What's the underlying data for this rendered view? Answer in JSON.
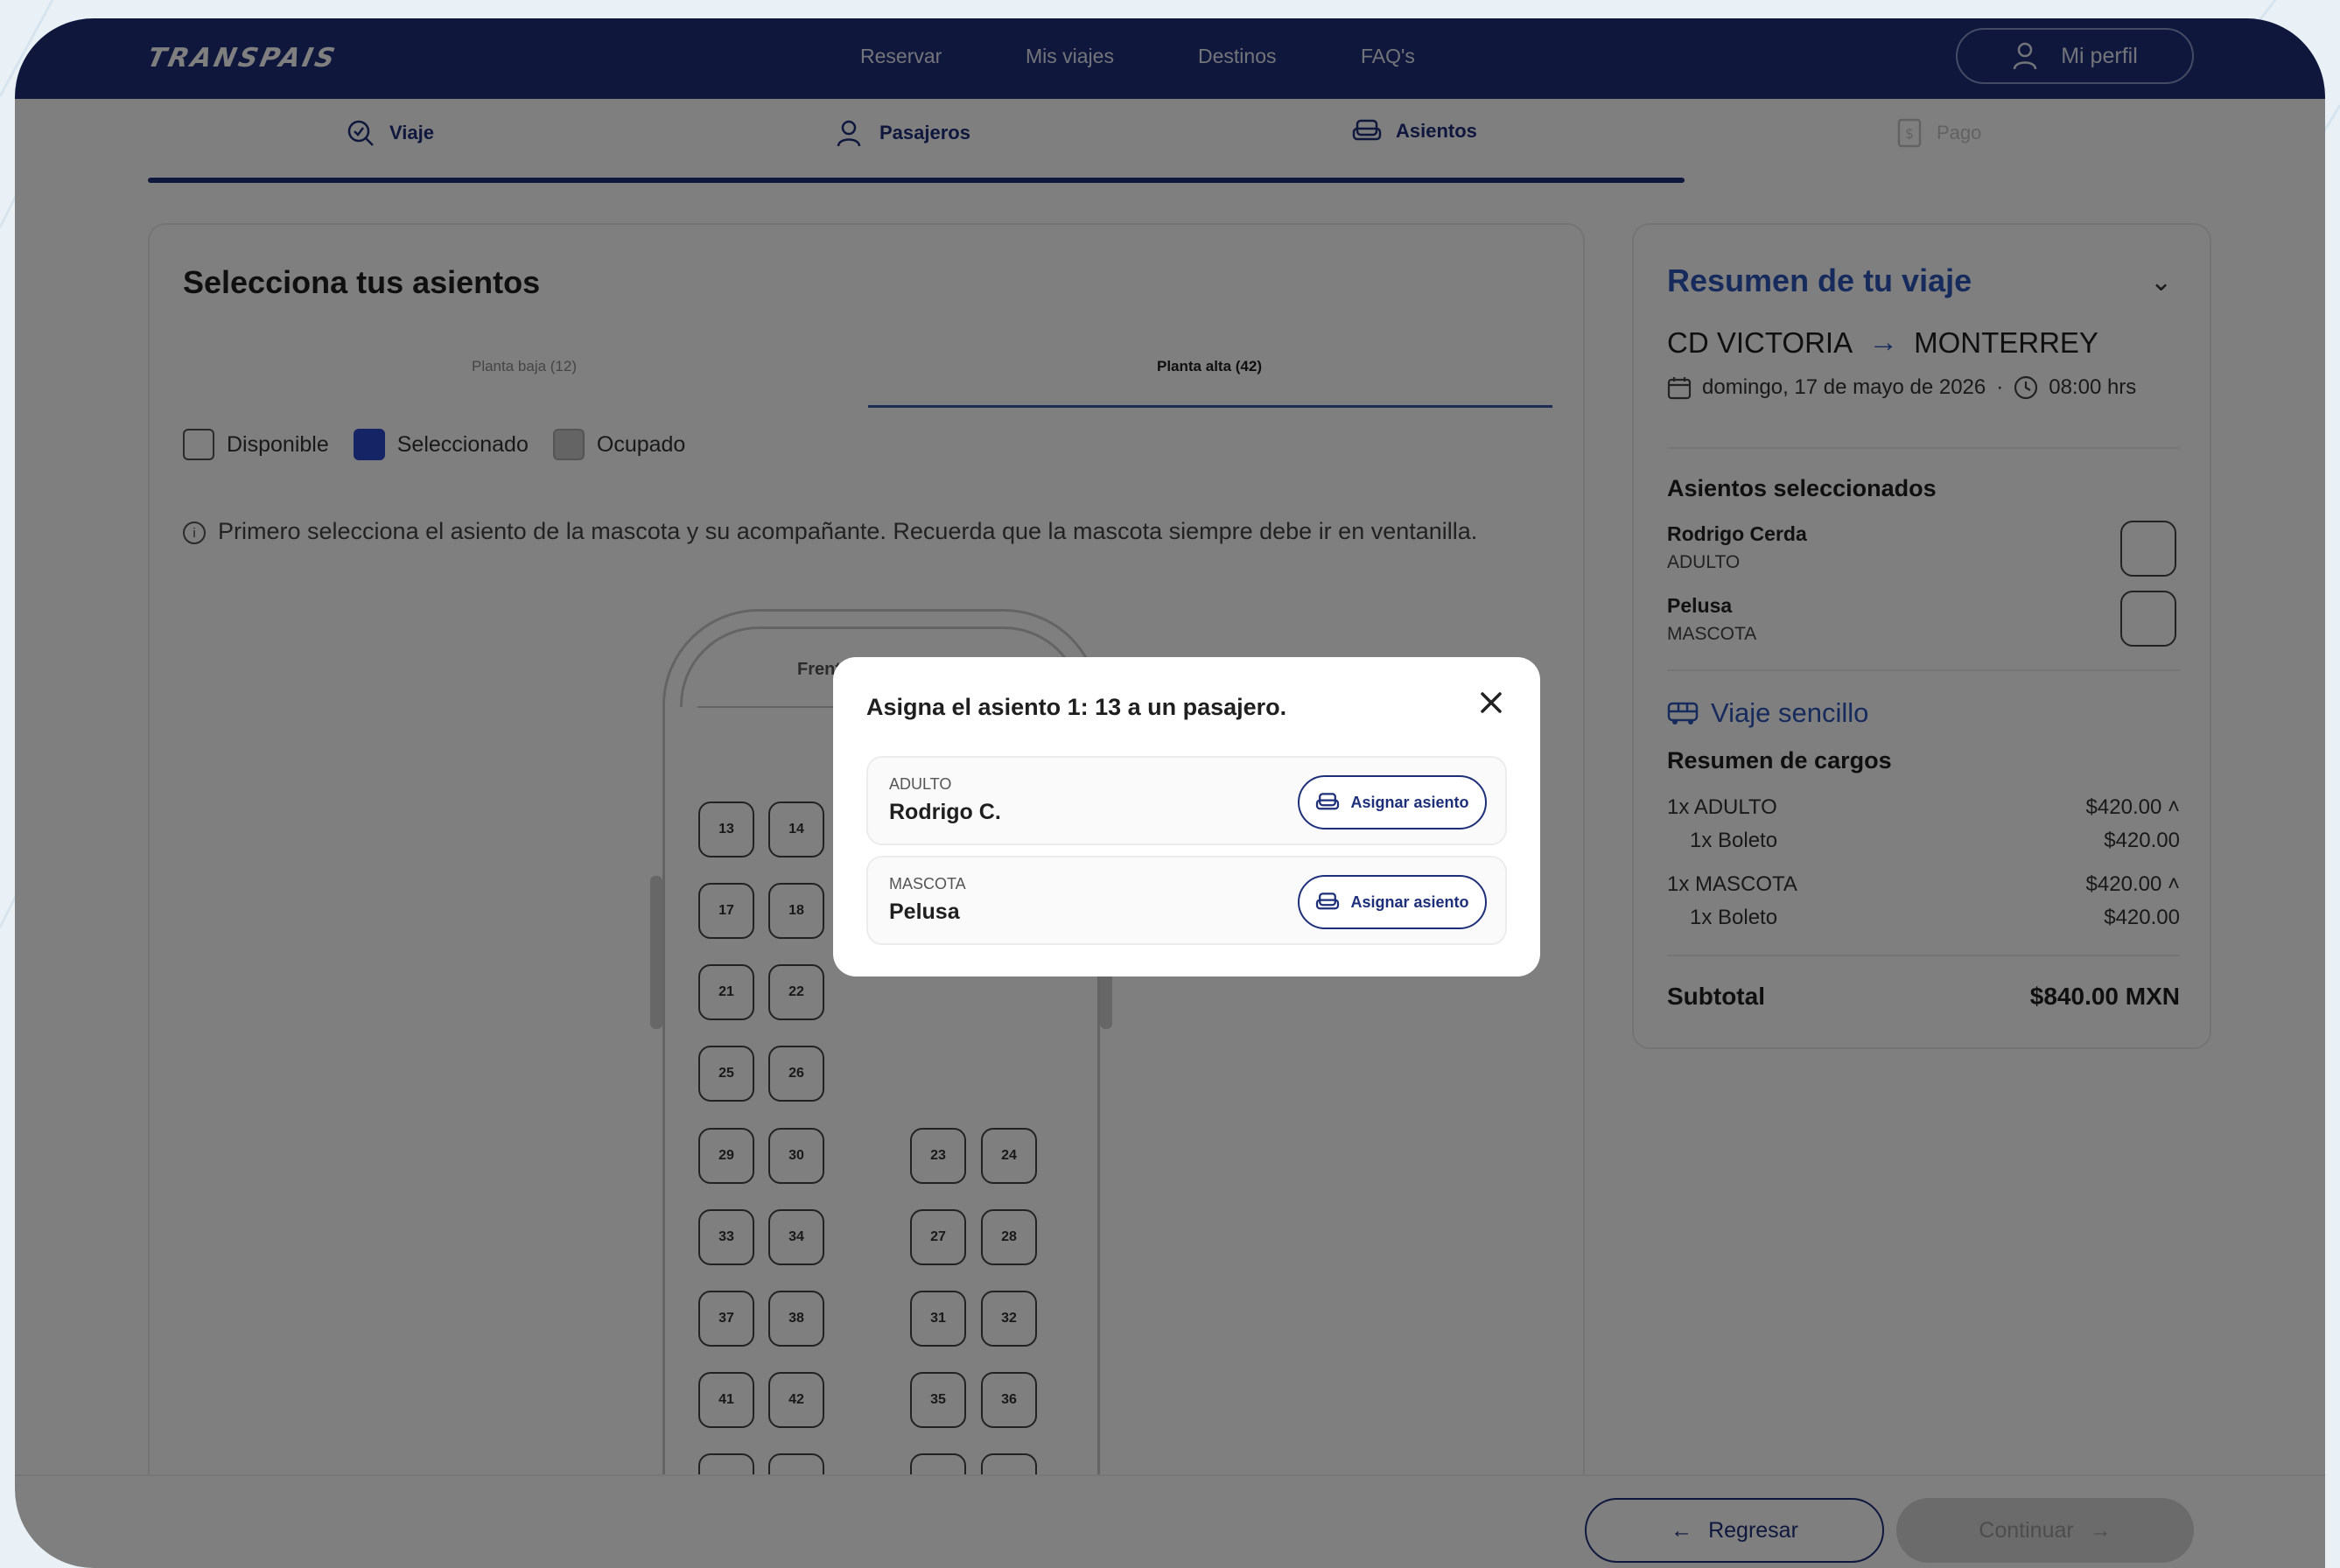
{
  "brand": {
    "logo_text": "Transpais"
  },
  "nav": {
    "items": [
      {
        "label": "Reservar"
      },
      {
        "label": "Mis viajes"
      },
      {
        "label": "Destinos"
      },
      {
        "label": "FAQ's"
      }
    ],
    "profile_label": "Mi perfil"
  },
  "steps": [
    {
      "label": "Viaje",
      "icon": "search-check-icon",
      "state": "done"
    },
    {
      "label": "Pasajeros",
      "icon": "user-icon",
      "state": "done"
    },
    {
      "label": "Asientos",
      "icon": "seat-icon",
      "state": "current"
    },
    {
      "label": "Pago",
      "icon": "receipt-icon",
      "state": "disabled"
    }
  ],
  "progress": 0.75,
  "seat_selection": {
    "title": "Selecciona tus asientos",
    "decks": [
      {
        "label": "Planta baja (12)",
        "active": false
      },
      {
        "label": "Planta alta (42)",
        "active": true
      }
    ],
    "legend": [
      {
        "label": "Disponible",
        "kind": "available"
      },
      {
        "label": "Seleccionado",
        "kind": "selected"
      },
      {
        "label": "Ocupado",
        "kind": "occupied"
      }
    ],
    "info": "Primero selecciona el asiento de la mascota y su acompañante. Recuerda que la mascota siempre debe ir en ventanilla.",
    "front_label": "Frente",
    "seats": [
      "13",
      "14",
      "17",
      "18",
      "21",
      "22",
      "25",
      "26",
      "29",
      "30",
      "23",
      "24",
      "33",
      "34",
      "27",
      "28",
      "37",
      "38",
      "31",
      "32",
      "41",
      "42",
      "35",
      "36"
    ]
  },
  "summary": {
    "title": "Resumen de tu viaje",
    "origin": "CD VICTORIA",
    "destination": "MONTERREY",
    "date": "domingo, 17 de mayo de 2026",
    "time": "08:00 hrs",
    "selected_seats_title": "Asientos seleccionados",
    "passengers": [
      {
        "name": "Rodrigo Cerda",
        "type": "ADULTO"
      },
      {
        "name": "Pelusa",
        "type": "MASCOTA"
      }
    ],
    "trip_type": "Viaje sencillo",
    "charges_title": "Resumen de cargos",
    "charges": [
      {
        "label": "1x ADULTO",
        "amount": "$420.00",
        "sub_label": "1x Boleto",
        "sub_amount": "$420.00"
      },
      {
        "label": "1x MASCOTA",
        "amount": "$420.00",
        "sub_label": "1x Boleto",
        "sub_amount": "$420.00"
      }
    ],
    "subtotal_label": "Subtotal",
    "subtotal_value": "$840.00 MXN"
  },
  "footer": {
    "back_label": "Regresar",
    "next_label": "Continuar"
  },
  "modal": {
    "title": "Asigna el asiento 1: 13 a un pasajero.",
    "options": [
      {
        "type": "ADULTO",
        "name": "Rodrigo C.",
        "button": "Asignar asiento"
      },
      {
        "type": "MASCOTA",
        "name": "Pelusa",
        "button": "Asignar asiento"
      }
    ]
  },
  "colors": {
    "brand_navy": "#1e2f7a",
    "accent_blue": "#2d55b8",
    "selected_seat": "#2b48c9"
  }
}
